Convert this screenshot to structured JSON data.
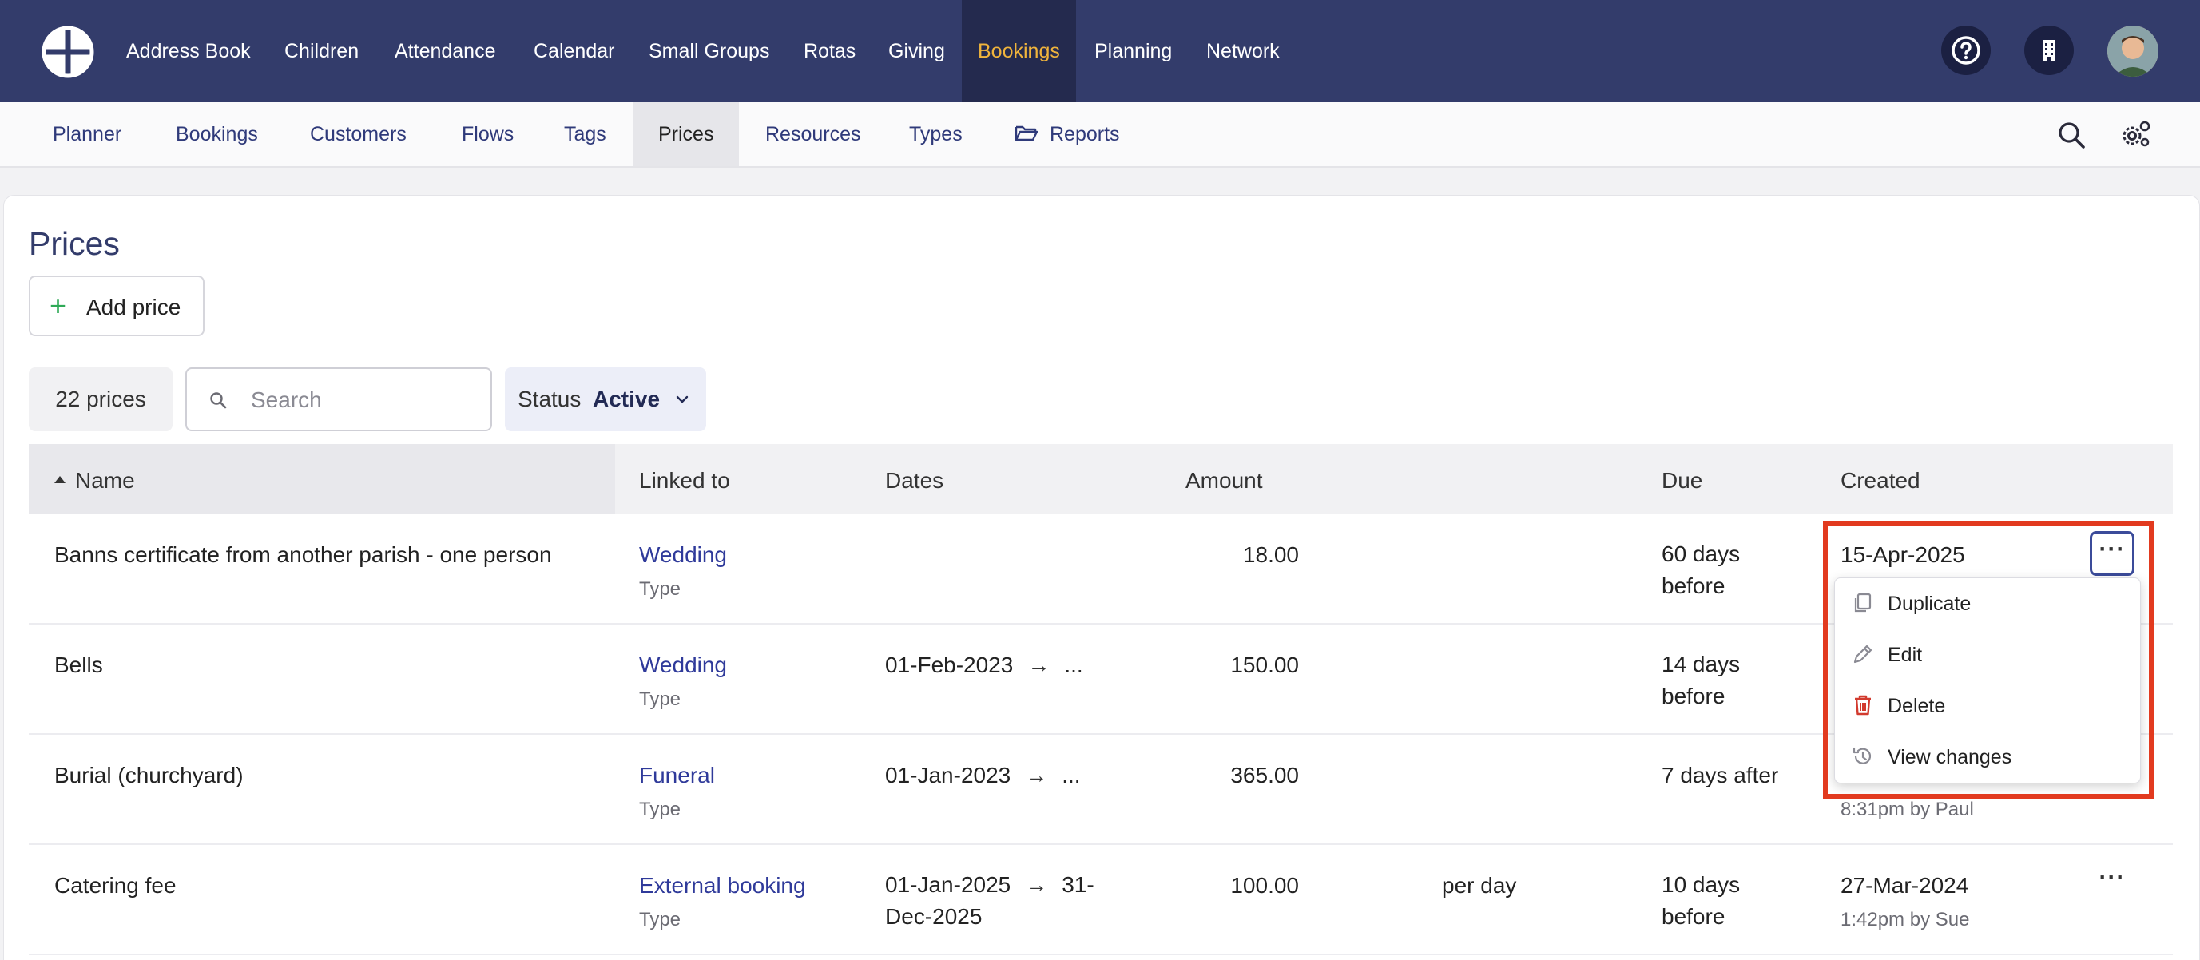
{
  "topnav": {
    "items": [
      "Address Book",
      "Children",
      "Attendance",
      "Calendar",
      "Small Groups",
      "Rotas",
      "Giving",
      "Bookings",
      "Planning",
      "Network"
    ],
    "active": "Bookings",
    "icons": [
      "help-icon",
      "building-icon",
      "avatar"
    ]
  },
  "subnav": {
    "items": [
      "Planner",
      "Bookings",
      "Customers",
      "Flows",
      "Tags",
      "Prices",
      "Resources",
      "Types",
      "Reports"
    ],
    "active": "Prices",
    "tools": [
      "search-icon",
      "settings-icon"
    ]
  },
  "page": {
    "title": "Prices",
    "add_label": "Add price"
  },
  "filters": {
    "count": "22 prices",
    "search_placeholder": "Search",
    "status_label": "Status",
    "status_value": "Active"
  },
  "table": {
    "headers": [
      "Name",
      "Linked to",
      "Dates",
      "Amount",
      "Due",
      "Created"
    ],
    "rows": [
      {
        "name": "Banns certificate from another parish - one person",
        "linked": "Wedding",
        "linked_sub": "Type",
        "date_start": "",
        "date_end": "",
        "amount": "18.00",
        "per": "",
        "due": "60 days before",
        "created": "15-Apr-2025",
        "created_sub": ""
      },
      {
        "name": "Bells",
        "linked": "Wedding",
        "linked_sub": "Type",
        "date_start": "01-Feb-2023",
        "date_end": "...",
        "amount": "150.00",
        "per": "",
        "due": "14 days before",
        "created": "",
        "created_sub": ""
      },
      {
        "name": "Burial (churchyard)",
        "linked": "Funeral",
        "linked_sub": "Type",
        "date_start": "01-Jan-2023",
        "date_end": "...",
        "amount": "365.00",
        "per": "",
        "due": "7 days after",
        "created": "",
        "created_sub": "8:31pm by Paul"
      },
      {
        "name": "Catering fee",
        "linked": "External booking",
        "linked_sub": "Type",
        "date_start": "01-Jan-2025",
        "date_end": "31-Dec-2025",
        "amount": "100.00",
        "per": "per day",
        "due": "10 days before",
        "created": "27-Mar-2024",
        "created_sub": "1:42pm by Sue"
      }
    ],
    "arrow": "→",
    "more_glyph": "···"
  },
  "menu": {
    "items": [
      {
        "label": "Duplicate",
        "icon": "duplicate-icon"
      },
      {
        "label": "Edit",
        "icon": "pencil-icon"
      },
      {
        "label": "Delete",
        "icon": "trash-icon"
      },
      {
        "label": "View changes",
        "icon": "history-icon"
      }
    ]
  },
  "colors": {
    "nav_bg": "#333c6b",
    "active_nav": "#f0b43c",
    "link": "#2f3a9a",
    "highlight": "#e23a1f",
    "delete_red": "#d23b2f"
  }
}
